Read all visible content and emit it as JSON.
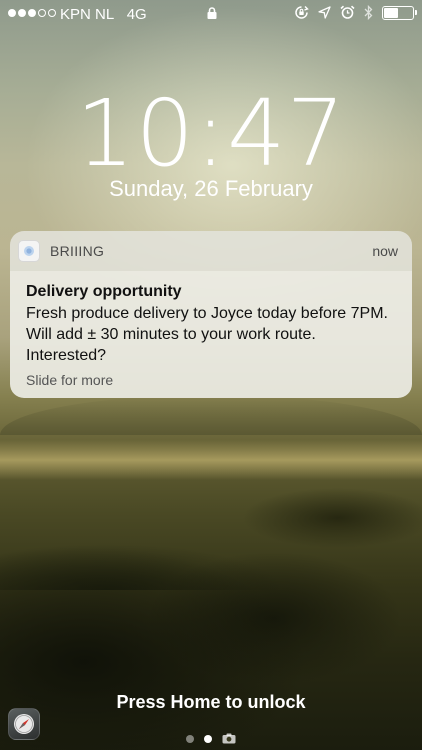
{
  "status_bar": {
    "signal_strength": 3,
    "signal_max": 5,
    "carrier": "KPN NL",
    "network": "4G",
    "battery_level": 0.5
  },
  "lock_screen": {
    "time": "10:47",
    "date": "Sunday, 26 February"
  },
  "notification": {
    "app_name": "BRIIING",
    "time": "now",
    "title": "Delivery opportunity",
    "body": "Fresh produce delivery to Joyce today before 7PM. Will add ± 30 minutes to your work route. Interested?",
    "action_hint": "Slide for more"
  },
  "footer": {
    "unlock_hint": "Press Home to unlock",
    "active_page": 1
  },
  "icons": [
    "lock-icon",
    "rotation-lock-icon",
    "location-arrow-icon",
    "alarm-icon",
    "bluetooth-icon",
    "battery-icon",
    "app-icon",
    "camera-icon",
    "compass-icon"
  ]
}
